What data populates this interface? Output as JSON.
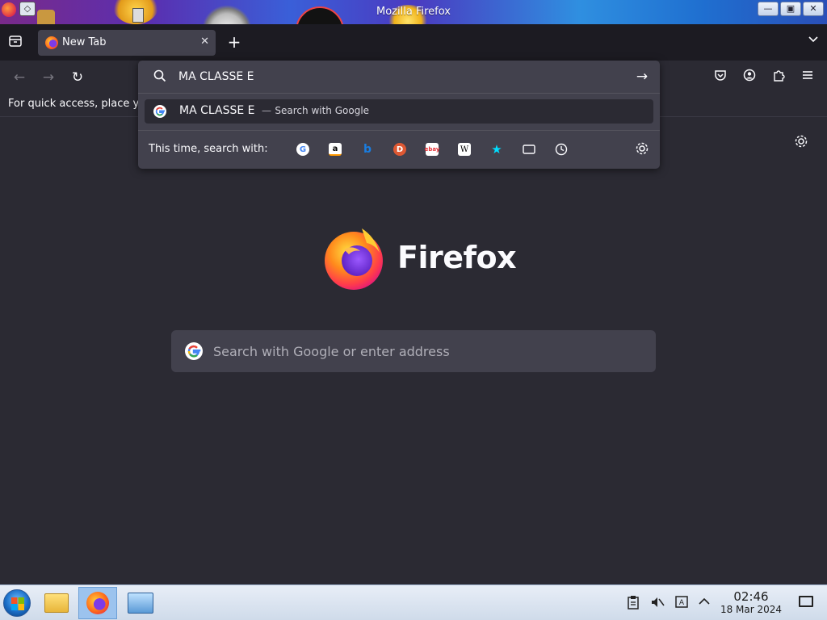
{
  "window": {
    "title": "Mozilla Firefox",
    "controls": {
      "minimize": "—",
      "maximize": "▣",
      "close": "✕"
    }
  },
  "tabs": [
    {
      "label": "New Tab",
      "close": "✕",
      "favicon": "firefox-icon"
    }
  ],
  "tabstrip": {
    "new_tab": "+",
    "list_all": "⌵"
  },
  "navbar": {
    "back": "←",
    "forward": "→",
    "reload": "↻",
    "icons": [
      "pocket-icon",
      "account-icon",
      "extensions-icon",
      "menu-icon"
    ]
  },
  "urlbar": {
    "value": "MA CLASSE E",
    "go": "→",
    "suggestion": {
      "query": "MA CLASSE E",
      "dash": "—",
      "action": "Search with Google"
    },
    "oneoff_label": "This time, search with:",
    "engines": [
      {
        "name": "google",
        "glyph": "G",
        "color": "#4285f4",
        "bg": "#ffffff"
      },
      {
        "name": "amazon",
        "glyph": "a",
        "color": "#000000",
        "bg": "#ffffff"
      },
      {
        "name": "bing",
        "glyph": "b",
        "color": "#1a7de0",
        "bg": "transparent"
      },
      {
        "name": "duckduckgo",
        "glyph": "D",
        "color": "#ffffff",
        "bg": "#de5833"
      },
      {
        "name": "ebay",
        "glyph": "ebay",
        "color": "#e53238",
        "bg": "#ffffff"
      },
      {
        "name": "wikipedia",
        "glyph": "W",
        "color": "#000000",
        "bg": "#ffffff"
      },
      {
        "name": "bookmarks",
        "glyph": "★",
        "color": "#00ddff",
        "bg": "transparent"
      },
      {
        "name": "tabs",
        "glyph": "▭",
        "color": "#fbfbfe",
        "bg": "transparent"
      },
      {
        "name": "history",
        "glyph": "◷",
        "color": "#fbfbfe",
        "bg": "transparent"
      }
    ]
  },
  "bookmarks_bar": {
    "hint": "For quick access, place y"
  },
  "newtab": {
    "brand": "Firefox",
    "search_placeholder": "Search with Google or enter address"
  },
  "taskbar": {
    "time": "02:46",
    "date": "18 Mar 2024"
  }
}
